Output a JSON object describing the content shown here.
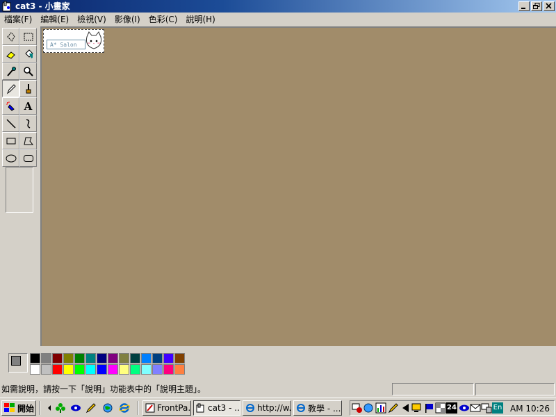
{
  "window": {
    "title": "cat3 - 小畫家",
    "icon": "paint-app-icon"
  },
  "menu": [
    "檔案(F)",
    "編輯(E)",
    "檢視(V)",
    "影像(I)",
    "色彩(C)",
    "說明(H)"
  ],
  "tools": [
    {
      "name": "free-form-select-icon"
    },
    {
      "name": "rect-select-icon"
    },
    {
      "name": "eraser-icon"
    },
    {
      "name": "fill-bucket-icon"
    },
    {
      "name": "color-picker-icon"
    },
    {
      "name": "magnifier-icon"
    },
    {
      "name": "pencil-icon",
      "active": true
    },
    {
      "name": "brush-icon"
    },
    {
      "name": "airbrush-icon"
    },
    {
      "name": "text-icon",
      "label": "A"
    },
    {
      "name": "line-icon"
    },
    {
      "name": "curve-icon"
    },
    {
      "name": "rectangle-icon"
    },
    {
      "name": "polygon-icon"
    },
    {
      "name": "ellipse-icon"
    },
    {
      "name": "rounded-rect-icon"
    }
  ],
  "canvas": {
    "background": "#a18c6a",
    "drawing_text": "A* Salon"
  },
  "palette": {
    "foreground": "#808080",
    "background": "#ffffff",
    "colors": [
      "#000000",
      "#808080",
      "#800000",
      "#808000",
      "#008000",
      "#008080",
      "#000080",
      "#800080",
      "#808040",
      "#004040",
      "#0080ff",
      "#004080",
      "#4000ff",
      "#804000",
      "#ffffff",
      "#c0c0c0",
      "#ff0000",
      "#ffff00",
      "#00ff00",
      "#00ffff",
      "#0000ff",
      "#ff00ff",
      "#ffff80",
      "#00ff80",
      "#80ffff",
      "#8080ff",
      "#ff0080",
      "#ff8040"
    ]
  },
  "status": {
    "text": "如需說明，請按一下「說明」功能表中的「說明主題」。"
  },
  "taskbar": {
    "start_label": "開始",
    "buttons": [
      {
        "label": "FrontPa...",
        "icon": "frontpage-icon"
      },
      {
        "label": "cat3 - ...",
        "icon": "paint-app-icon",
        "active": true
      },
      {
        "label": "http://w...",
        "icon": "ie-icon"
      },
      {
        "label": "教學 - ...",
        "icon": "ie-icon"
      }
    ],
    "clock": "AM 10:26",
    "lang": "En",
    "date_badge": "24"
  }
}
